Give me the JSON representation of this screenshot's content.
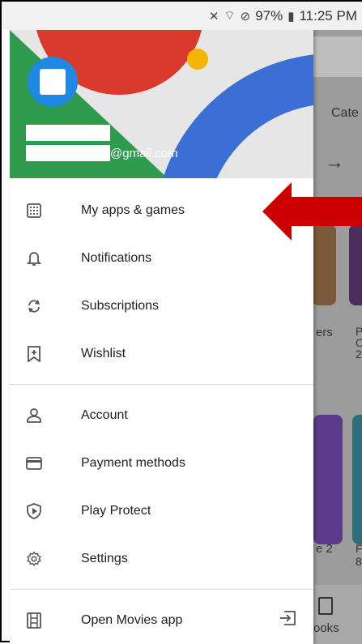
{
  "status_bar": {
    "battery": "97%",
    "time": "11:25 PM",
    "icons": [
      "mute-icon",
      "wifi-icon",
      "no-disturb-icon",
      "battery-icon"
    ]
  },
  "account": {
    "email_suffix": "@gmail.com"
  },
  "menu_group_1": [
    {
      "label": "My apps & games",
      "icon": "apps-grid-icon"
    },
    {
      "label": "Notifications",
      "icon": "bell-icon"
    },
    {
      "label": "Subscriptions",
      "icon": "refresh-icon"
    },
    {
      "label": "Wishlist",
      "icon": "bookmark-plus-icon"
    }
  ],
  "menu_group_2": [
    {
      "label": "Account",
      "icon": "person-icon"
    },
    {
      "label": "Payment methods",
      "icon": "credit-card-icon"
    },
    {
      "label": "Play Protect",
      "icon": "shield-play-icon"
    },
    {
      "label": "Settings",
      "icon": "gear-icon"
    }
  ],
  "menu_group_3": [
    {
      "label": "Open Movies app",
      "icon": "film-icon",
      "trail_icon": "exit-icon"
    }
  ],
  "background_app": {
    "category_text": "Cate",
    "text_ers": "ers",
    "text_p": "P\nO\n2",
    "text_e2": "e 2",
    "text_f8": "F\n8",
    "books_text": "ooks"
  },
  "colors": {
    "header_green": "#2e9b4e",
    "header_red": "#d93a2b",
    "header_blue": "#3b6fd6",
    "header_yellow": "#f4b400",
    "avatar_blue": "#1e88e5",
    "arrow_red": "#cc0000"
  }
}
